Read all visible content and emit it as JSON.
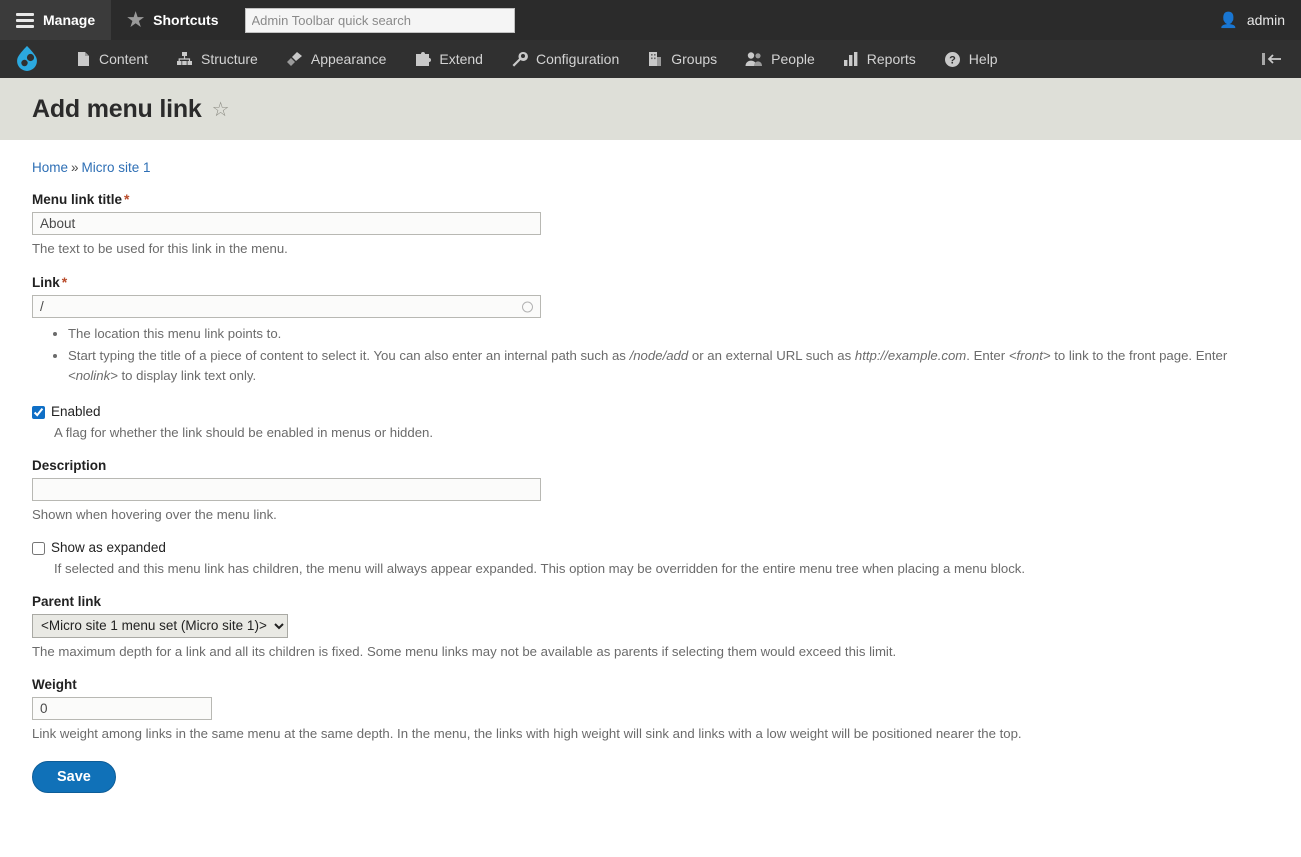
{
  "toolbar": {
    "manage_label": "Manage",
    "shortcuts_label": "Shortcuts",
    "search_placeholder": "Admin Toolbar quick search",
    "search_value": "",
    "user_label": "admin"
  },
  "nav": {
    "logo_name": "drupal-droplet-logo",
    "items": [
      {
        "label": "Content",
        "icon": "document-icon"
      },
      {
        "label": "Structure",
        "icon": "sitemap-icon"
      },
      {
        "label": "Appearance",
        "icon": "paintbrush-icon"
      },
      {
        "label": "Extend",
        "icon": "puzzle-icon"
      },
      {
        "label": "Configuration",
        "icon": "wrench-icon"
      },
      {
        "label": "Groups",
        "icon": "building-icon"
      },
      {
        "label": "People",
        "icon": "people-icon"
      },
      {
        "label": "Reports",
        "icon": "bar-chart-icon"
      },
      {
        "label": "Help",
        "icon": "question-circle-icon"
      }
    ],
    "collapse_icon": "collapse-toolbar-icon"
  },
  "page": {
    "title": "Add menu link",
    "favorite_icon": "star-outline-icon"
  },
  "breadcrumb": {
    "home": "Home",
    "separator": "»",
    "current": "Micro site 1"
  },
  "form": {
    "menu_link_title": {
      "label": "Menu link title",
      "required_mark": "*",
      "value": "About",
      "placeholder": "",
      "description": "The text to be used for this link in the menu."
    },
    "link": {
      "label": "Link",
      "required_mark": "*",
      "value": "/",
      "placeholder": "",
      "hint1": "The location this menu link points to.",
      "hint2_part1": "Start typing the title of a piece of content to select it. You can also enter an internal path such as ",
      "hint2_em1": "/node/add",
      "hint2_part2": " or an external URL such as ",
      "hint2_em2": "http://example.com",
      "hint2_part3": ". Enter ",
      "hint2_em3": "<front>",
      "hint2_part4": " to link to the front page. Enter ",
      "hint2_em4": "<nolink>",
      "hint2_part5": " to display link text only."
    },
    "enabled": {
      "label": "Enabled",
      "checked": true,
      "description": "A flag for whether the link should be enabled in menus or hidden."
    },
    "description_field": {
      "label": "Description",
      "value": "",
      "placeholder": "",
      "description": "Shown when hovering over the menu link."
    },
    "show_expanded": {
      "label": "Show as expanded",
      "checked": false,
      "description": "If selected and this menu link has children, the menu will always appear expanded. This option may be overridden for the entire menu tree when placing a menu block."
    },
    "parent_link": {
      "label": "Parent link",
      "selected": "<Micro site 1 menu set (Micro site 1)>",
      "options": [
        "<Micro site 1 menu set (Micro site 1)>"
      ],
      "description": "The maximum depth for a link and all its children is fixed. Some menu links may not be available as parents if selecting them would exceed this limit."
    },
    "weight": {
      "label": "Weight",
      "value": "0",
      "placeholder": "",
      "description": "Link weight among links in the same menu at the same depth. In the menu, the links with high weight will sink and links with a low weight will be positioned nearer the top."
    },
    "save_label": "Save"
  },
  "colors": {
    "toolbar_bg": "#0f0f0f",
    "nav_bg": "#303030",
    "title_band": "#dedfd8",
    "link_blue": "#2e6fb5",
    "button_blue": "#1071b8",
    "required_red": "#b94b2a",
    "drupal_blue": "#2ba9e0"
  }
}
